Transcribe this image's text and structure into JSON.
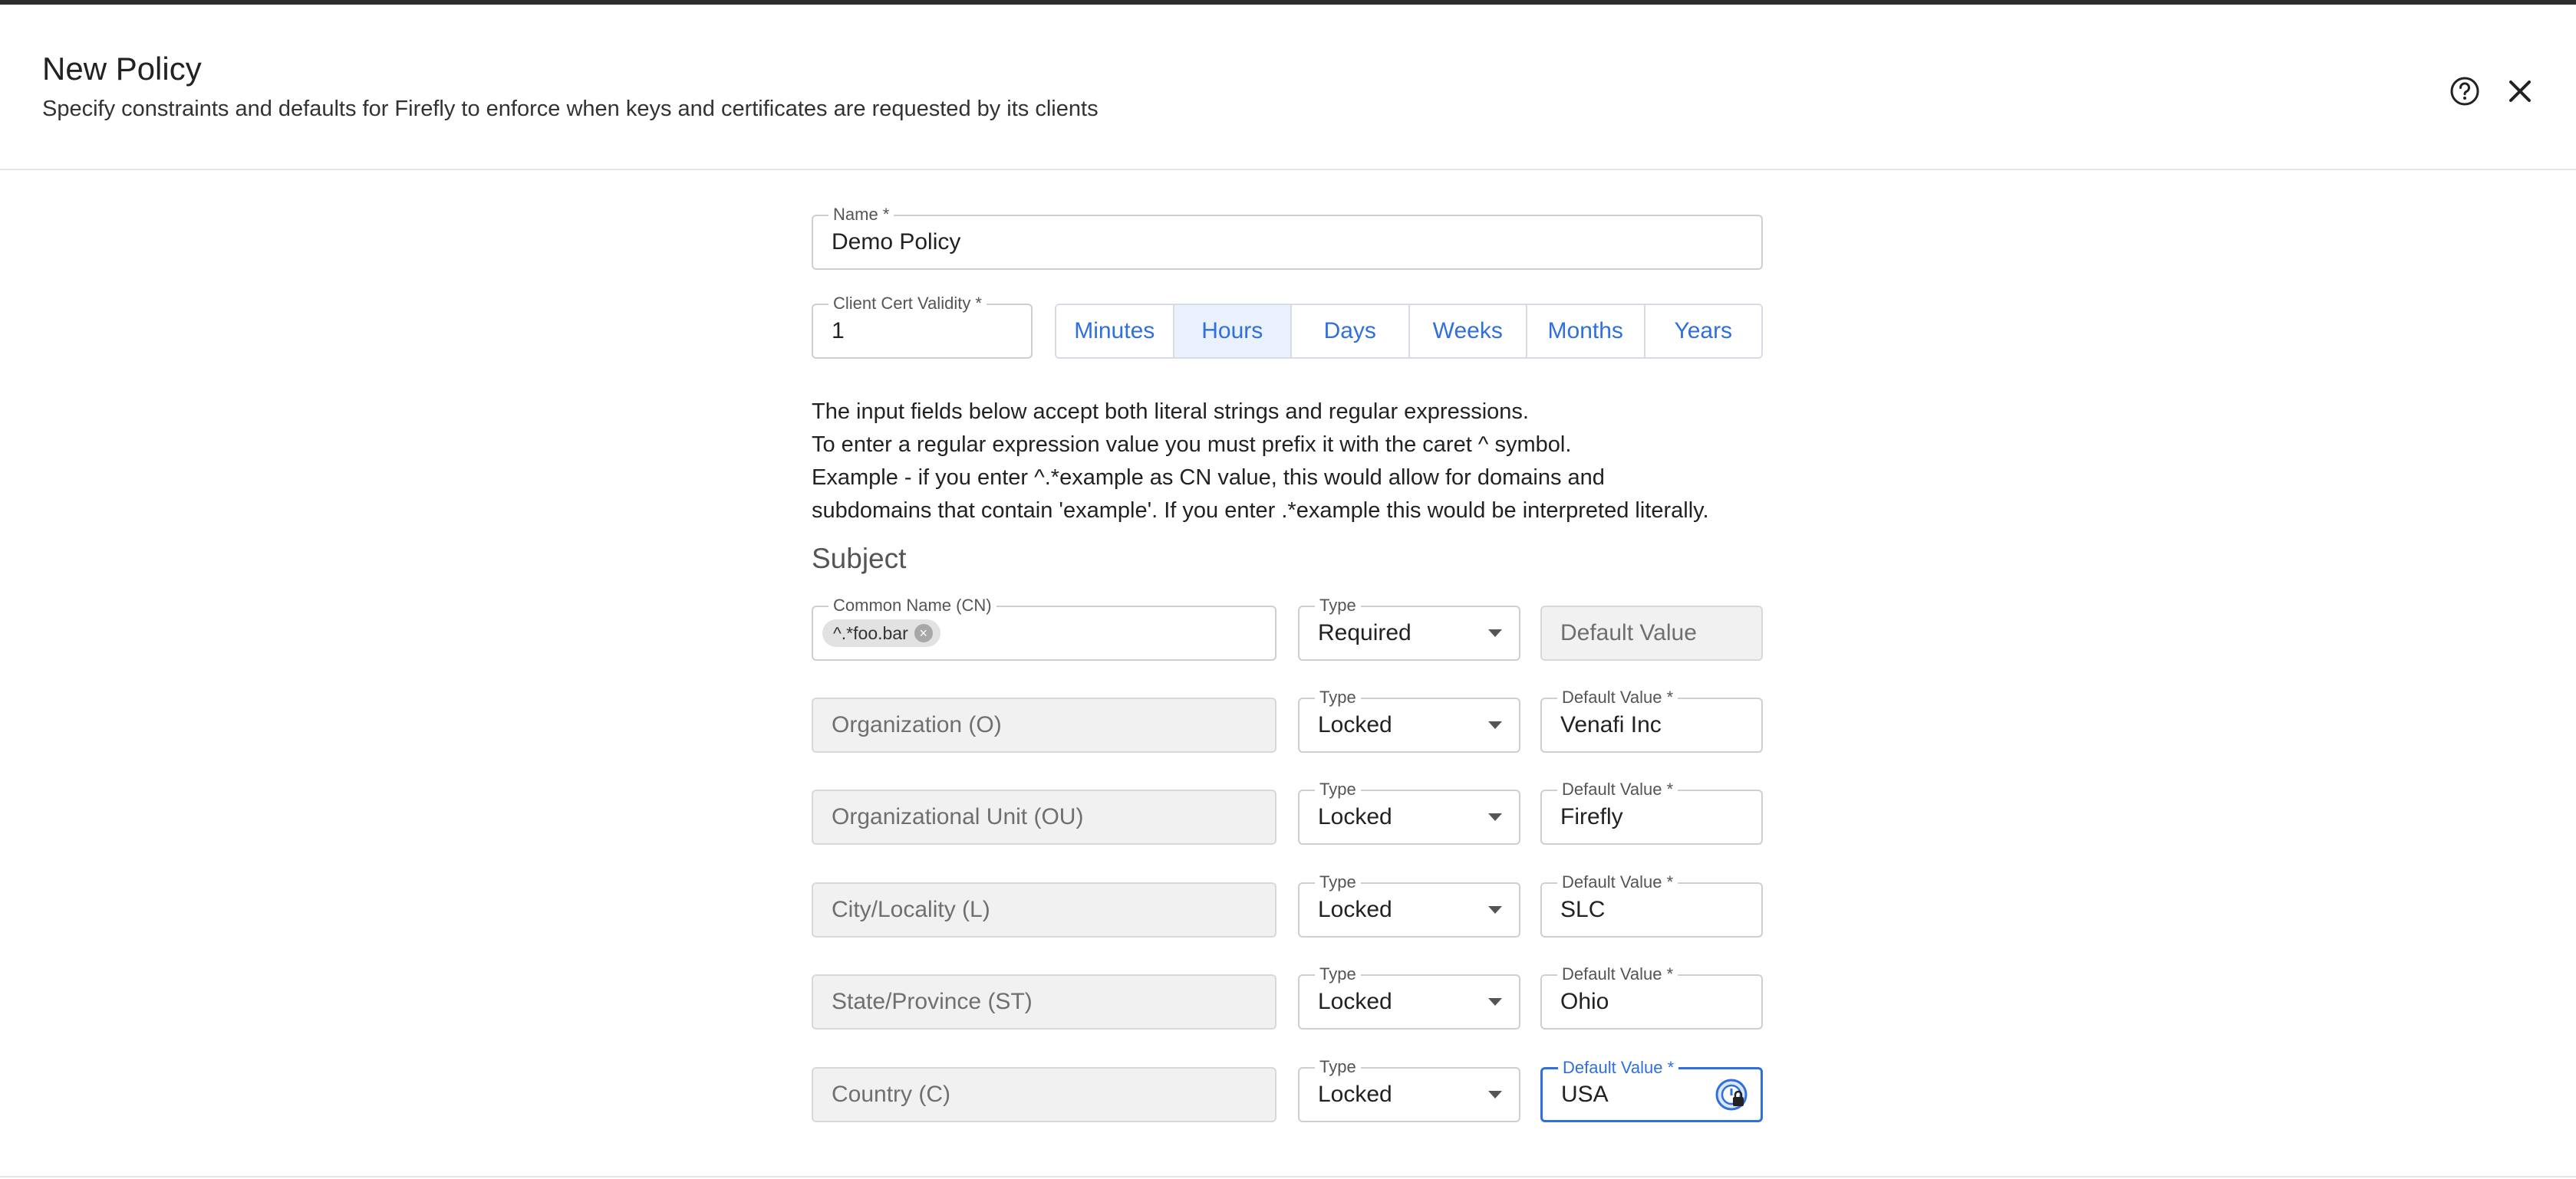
{
  "header": {
    "title": "New Policy",
    "subtitle": "Specify constraints and defaults for Firefly to enforce when keys and certificates are requested by its clients",
    "help_icon": "question-circle-icon",
    "close_icon": "close-icon"
  },
  "form": {
    "name": {
      "label": "Name *",
      "value": "Demo Policy"
    },
    "validity": {
      "label": "Client Cert Validity *",
      "value": "1",
      "units": [
        "Minutes",
        "Hours",
        "Days",
        "Weeks",
        "Months",
        "Years"
      ],
      "selected_unit": "Hours"
    },
    "info_lines": [
      "The input fields below accept both literal strings and regular expressions.",
      "To enter a regular expression value you must prefix it with the caret ^ symbol.",
      "Example - if you enter ^.*example as CN value, this would allow for domains and",
      "subdomains that contain 'example'. If you enter .*example this would be interpreted literally."
    ],
    "section_title": "Subject"
  },
  "subject": {
    "cn": {
      "label": "Common Name (CN)",
      "chip": "^.*foo.bar",
      "type_label": "Type",
      "type_value": "Required",
      "default_placeholder": "Default Value"
    },
    "rows": [
      {
        "attr": "Organization (O)",
        "type_label": "Type",
        "type_value": "Locked",
        "default_label": "Default Value *",
        "default_value": "Venafi Inc"
      },
      {
        "attr": "Organizational Unit (OU)",
        "type_label": "Type",
        "type_value": "Locked",
        "default_label": "Default Value *",
        "default_value": "Firefly"
      },
      {
        "attr": "City/Locality (L)",
        "type_label": "Type",
        "type_value": "Locked",
        "default_label": "Default Value *",
        "default_value": "SLC"
      },
      {
        "attr": "State/Province (ST)",
        "type_label": "Type",
        "type_value": "Locked",
        "default_label": "Default Value *",
        "default_value": "Ohio"
      },
      {
        "attr": "Country (C)",
        "type_label": "Type",
        "type_value": "Locked",
        "default_label": "Default Value *",
        "default_value": "USA"
      }
    ]
  },
  "colors": {
    "accent": "#2f6fde",
    "border": "#cfcfcf",
    "disabled_bg": "#f1f1f1"
  }
}
